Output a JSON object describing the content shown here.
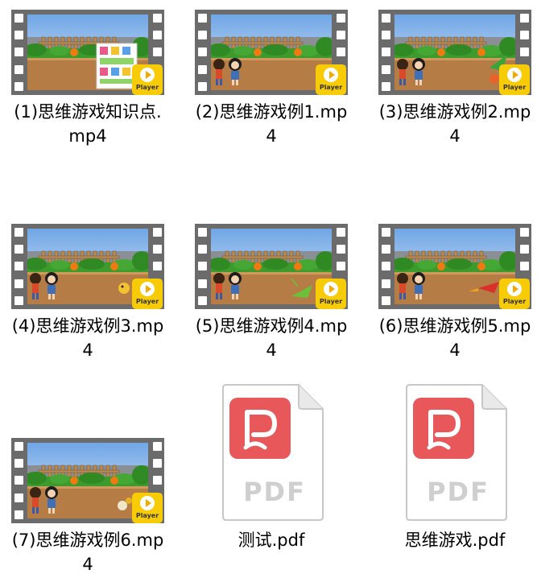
{
  "files": [
    {
      "name": "(1)思维游戏知识点.mp4",
      "type": "video",
      "thumb_icon": "video-thumbnail",
      "badge_text": "Player"
    },
    {
      "name": "(2)思维游戏例1.mp4",
      "type": "video",
      "thumb_icon": "video-thumbnail",
      "badge_text": "Player"
    },
    {
      "name": "(3)思维游戏例2.mp4",
      "type": "video",
      "thumb_icon": "video-thumbnail",
      "badge_text": "Player"
    },
    {
      "name": "(4)思维游戏例3.mp4",
      "type": "video",
      "thumb_icon": "video-thumbnail",
      "badge_text": "Player"
    },
    {
      "name": "(5)思维游戏例4.mp4",
      "type": "video",
      "thumb_icon": "video-thumbnail",
      "badge_text": "Player"
    },
    {
      "name": "(6)思维游戏例5.mp4",
      "type": "video",
      "thumb_icon": "video-thumbnail",
      "badge_text": "Player"
    },
    {
      "name": "(7)思维游戏例6.mp4",
      "type": "video",
      "thumb_icon": "video-thumbnail",
      "badge_text": "Player"
    },
    {
      "name": "测试.pdf",
      "type": "pdf",
      "thumb_icon": "pdf-file-icon",
      "badge_text": "PDF"
    },
    {
      "name": "思维游戏.pdf",
      "type": "pdf",
      "thumb_icon": "pdf-file-icon",
      "badge_text": "PDF"
    }
  ],
  "colors": {
    "film_strip": "#6b6b6b",
    "player_badge": "#f7cc06",
    "pdf_logo": "#e8585a",
    "pdf_text": "#cfcfcf"
  }
}
